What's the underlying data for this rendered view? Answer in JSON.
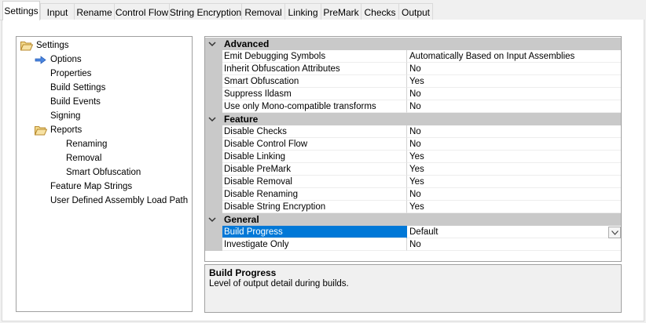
{
  "tabs": [
    {
      "label": "Settings",
      "active": true
    },
    {
      "label": "Input",
      "active": false
    },
    {
      "label": "Rename",
      "active": false
    },
    {
      "label": "Control Flow",
      "active": false
    },
    {
      "label": "String Encryption",
      "active": false
    },
    {
      "label": "Removal",
      "active": false
    },
    {
      "label": "Linking",
      "active": false
    },
    {
      "label": "PreMark",
      "active": false
    },
    {
      "label": "Checks",
      "active": false
    },
    {
      "label": "Output",
      "active": false
    }
  ],
  "tree": {
    "items": [
      {
        "label": "Settings",
        "icon": "folder-open-icon"
      },
      {
        "label": "Options",
        "icon": "arrow-right-icon",
        "selected": true
      },
      {
        "label": "Properties"
      },
      {
        "label": "Build Settings"
      },
      {
        "label": "Build Events"
      },
      {
        "label": "Signing"
      },
      {
        "label": "Reports",
        "icon": "folder-open-icon"
      },
      {
        "label": "Renaming"
      },
      {
        "label": "Removal"
      },
      {
        "label": "Smart Obfuscation"
      },
      {
        "label": "Feature Map Strings"
      },
      {
        "label": "User Defined Assembly Load Path"
      }
    ]
  },
  "property_grid": {
    "categories": [
      {
        "label": "Advanced",
        "rows": [
          {
            "name": "Emit Debugging Symbols",
            "value": "Automatically Based on Input Assemblies"
          },
          {
            "name": "Inherit Obfuscation Attributes",
            "value": "No"
          },
          {
            "name": "Smart Obfuscation",
            "value": "Yes"
          },
          {
            "name": "Suppress Ildasm",
            "value": "No"
          },
          {
            "name": "Use only Mono-compatible transforms",
            "value": "No"
          }
        ]
      },
      {
        "label": "Feature",
        "rows": [
          {
            "name": "Disable Checks",
            "value": "No"
          },
          {
            "name": "Disable Control Flow",
            "value": "No"
          },
          {
            "name": "Disable Linking",
            "value": "Yes"
          },
          {
            "name": "Disable PreMark",
            "value": "Yes"
          },
          {
            "name": "Disable Removal",
            "value": "Yes"
          },
          {
            "name": "Disable Renaming",
            "value": "No"
          },
          {
            "name": "Disable String Encryption",
            "value": "Yes"
          }
        ]
      },
      {
        "label": "General",
        "rows": [
          {
            "name": "Build Progress",
            "value": "Default",
            "selected": true
          },
          {
            "name": "Investigate Only",
            "value": "No"
          }
        ]
      }
    ]
  },
  "description": {
    "title": "Build Progress",
    "text": "Level of output detail during builds."
  },
  "colors": {
    "selection": "#0078d7",
    "category_band": "#c9c9c9",
    "arrow_blue": "#3c7bd8",
    "folder_yellow": "#e8c77a"
  }
}
